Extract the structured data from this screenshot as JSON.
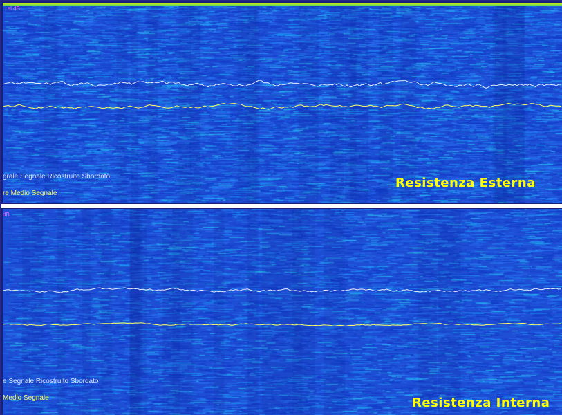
{
  "panels": [
    {
      "corner_label": "...el dB",
      "legend_integral": "grale Segnale Ricostruito Sbordato",
      "legend_mean": "re Medio Segnale",
      "title": "Resistenza Esterna"
    },
    {
      "corner_label": "dB",
      "legend_integral": "e Segnale Ricostruito Sbordato",
      "legend_mean": "Medio Segnale",
      "title": "Resistenza Interna"
    }
  ],
  "colors": {
    "background_blue": "#1f4fd6",
    "trace_white": "#e8f0ff",
    "trace_yellow": "#ffff66",
    "title_yellow": "#ffff00",
    "divider_white": "#ffffff",
    "label_magenta": "#ff66ff"
  }
}
